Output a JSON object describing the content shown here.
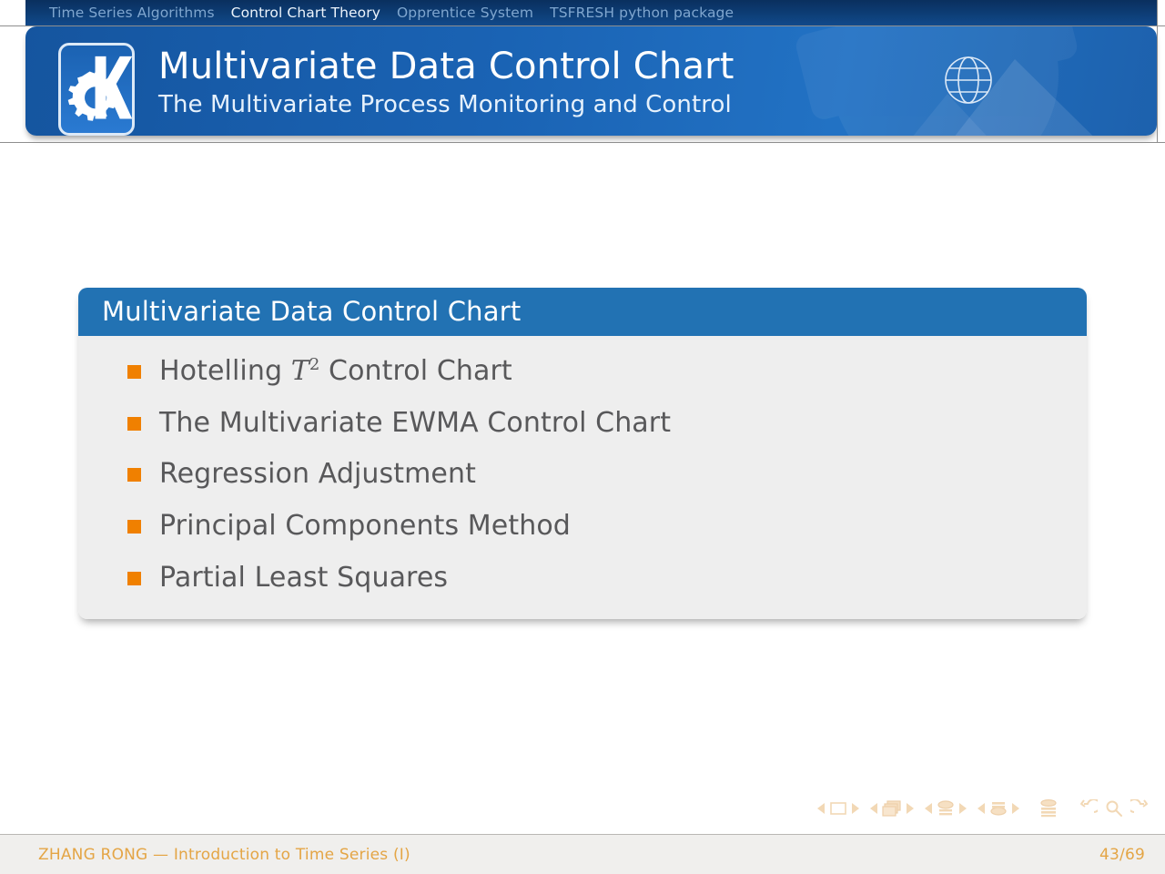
{
  "navbar": {
    "items": [
      {
        "label": "Time Series Algorithms",
        "active": false
      },
      {
        "label": "Control Chart Theory",
        "active": true
      },
      {
        "label": "Opprentice System",
        "active": false
      },
      {
        "label": "TSFRESH python package",
        "active": false
      }
    ]
  },
  "banner": {
    "title": "Multivariate Data Control Chart",
    "subtitle": "The Multivariate Process Monitoring and Control",
    "logo_icon": "kde-gear-k-logo",
    "globe_icon": "globe-icon"
  },
  "block": {
    "title": "Multivariate Data Control Chart",
    "items": [
      {
        "prefix": "Hotelling ",
        "math": "T",
        "sup": "2",
        "suffix": " Control Chart"
      },
      {
        "prefix": "The Multivariate EWMA Control Chart",
        "math": "",
        "sup": "",
        "suffix": ""
      },
      {
        "prefix": "Regression Adjustment",
        "math": "",
        "sup": "",
        "suffix": ""
      },
      {
        "prefix": "Principal Components Method",
        "math": "",
        "sup": "",
        "suffix": ""
      },
      {
        "prefix": "Partial Least Squares",
        "math": "",
        "sup": "",
        "suffix": ""
      }
    ]
  },
  "navsyms": {
    "icons": [
      "prev-slide-arrow",
      "slide-icon",
      "next-slide-arrow",
      "prev-frame-arrow",
      "frames-icon",
      "next-frame-arrow",
      "prev-subsection-arrow",
      "subsection-icon",
      "next-subsection-arrow",
      "prev-section-arrow",
      "section-icon",
      "next-section-arrow",
      "document-icon",
      "back-icon",
      "search-icon",
      "forward-icon"
    ]
  },
  "footer": {
    "left": "ZHANG RONG — Introduction to Time Series (I)",
    "right": "43/69"
  },
  "colors": {
    "navbar_bg": "#0d3e76",
    "banner_blue": "#1a63b4",
    "block_title_bg": "#2272b3",
    "block_body_bg": "#eeeeee",
    "bullet_orange": "#f08000",
    "text_grey": "#58585a",
    "footer_bg": "#f0efed",
    "footer_text": "#e4a545"
  }
}
